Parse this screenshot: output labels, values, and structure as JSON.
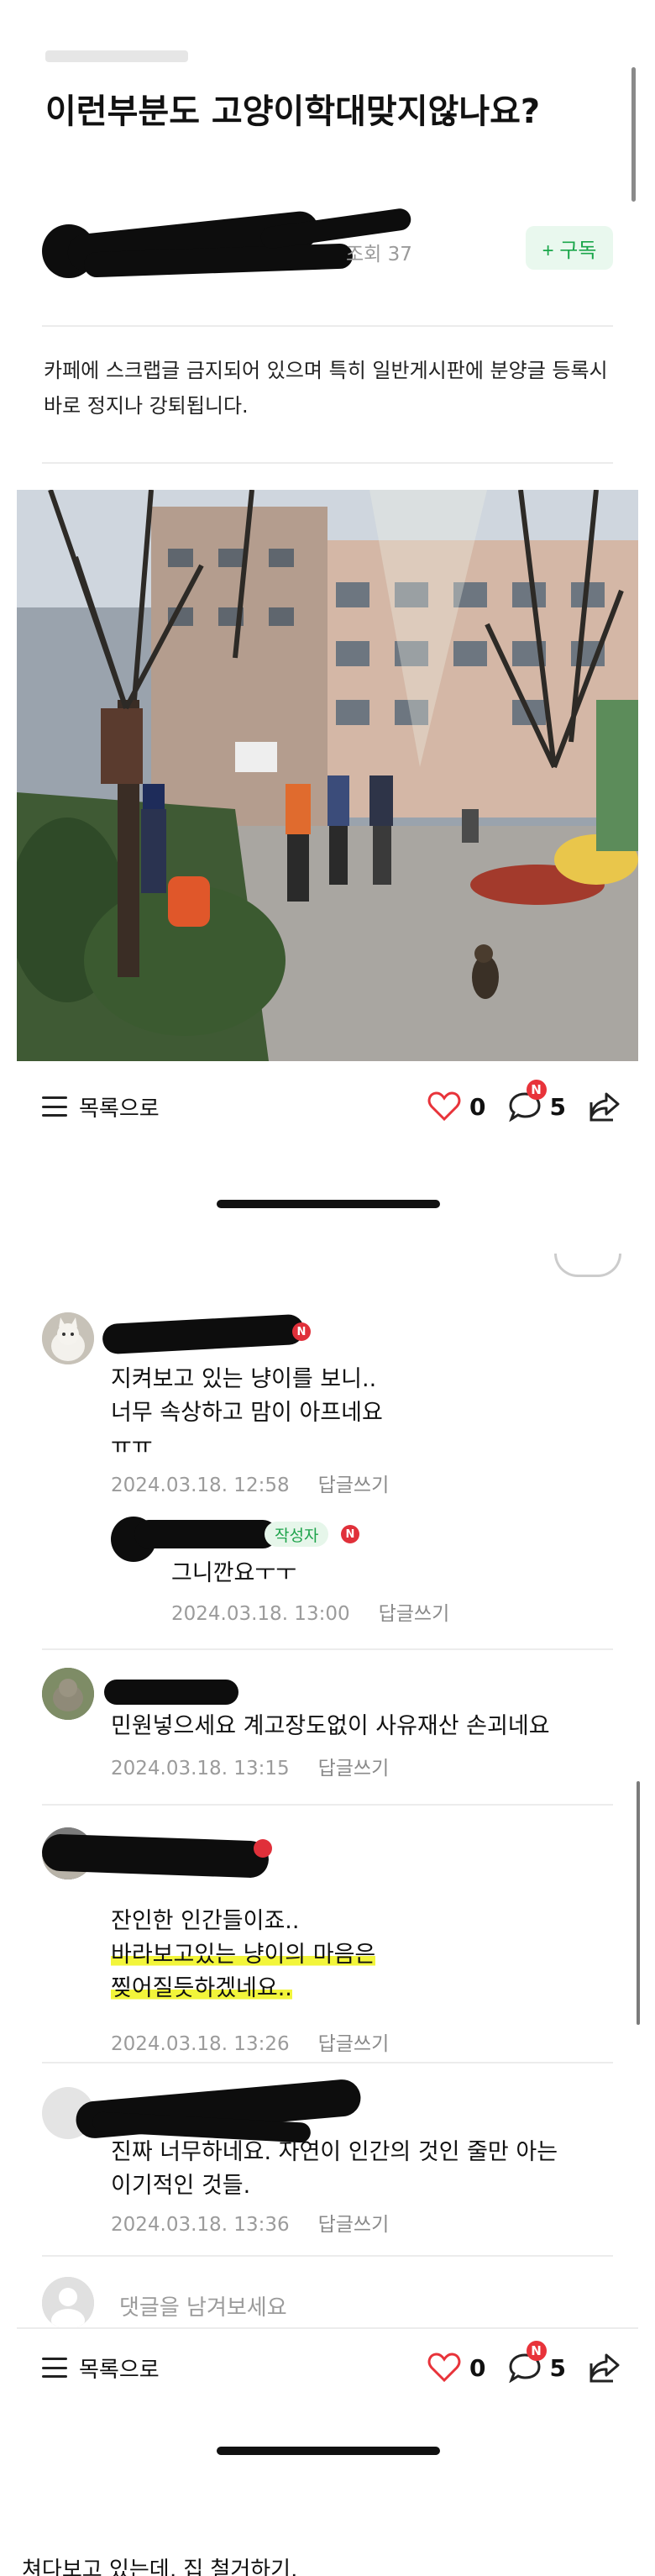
{
  "post": {
    "title": "이런부분도 고양이학대맞지않나요?",
    "views": "조회 37",
    "subscribe_label": "+ 구독",
    "notice": "카페에 스크랩글 금지되어 있으며 특히 일반게시판에 분양글 등록시 바로 정지나 강퇴됩니다.",
    "accent": "#1aa64a"
  },
  "action_bar": {
    "list_label": "목록으로",
    "like_count": "0",
    "comment_count": "5",
    "badge": "N",
    "icons": [
      "menu-icon",
      "heart-icon",
      "comment-icon",
      "share-icon"
    ]
  },
  "comments": [
    {
      "text_lines": [
        "지켜보고 있는 냥이를 보니..",
        "너무 속상하고 맘이 아프네요",
        "ㅠㅠ"
      ],
      "date": "2024.03.18. 12:58",
      "reply": "답글쓰기",
      "badge": "N"
    },
    {
      "text_lines": [
        "그니깐요ㅜㅜ"
      ],
      "date": "2024.03.18. 13:00",
      "reply": "답글쓰기",
      "author_tag": "작성자",
      "badge": "N"
    },
    {
      "text_lines": [
        "민원넣으세요 계고장도없이 사유재산 손괴네요"
      ],
      "date": "2024.03.18. 13:15",
      "reply": "답글쓰기"
    },
    {
      "text_lines": [
        "잔인한 인간들이죠..",
        "바라보고있는 냥이의 마음은",
        "찢어질듯하겠네요.."
      ],
      "date": "2024.03.18. 13:26",
      "reply": "답글쓰기",
      "badge": "N"
    },
    {
      "text_lines": [
        "진짜 너무하네요. 자연이 인간의 것인 줄만 아는",
        "이기적인 것들."
      ],
      "date": "2024.03.18. 13:36",
      "reply": "답글쓰기"
    }
  ],
  "comment_input": {
    "placeholder": "댓글을 남겨보세요"
  },
  "caption": "쳐다보고 있는데, 집 철거하기."
}
